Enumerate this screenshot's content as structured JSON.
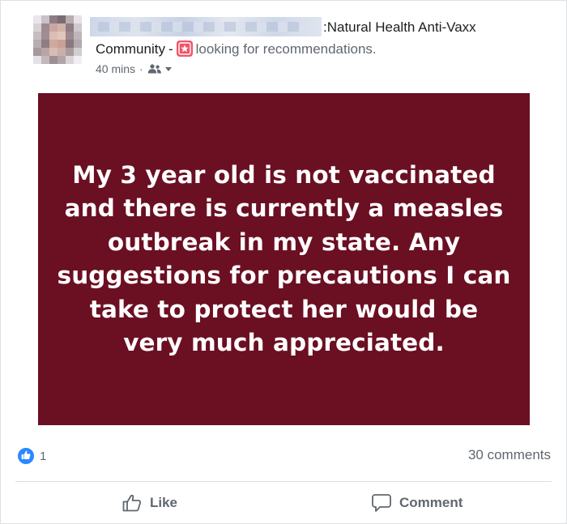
{
  "post": {
    "group_name": ":Natural Health Anti-Vaxx",
    "group_name_cont": "Community",
    "separator": "-",
    "activity": "looking for recommendations.",
    "time": "40 mins",
    "dot": "·",
    "audience_icon": "group-icon",
    "image_text": "My 3 year old is not vaccinated and there is currently a measles outbreak in my state. Any suggestions for precautions I can take to protect her would be very much appreciated.",
    "image_bg_color": "#6b0f22"
  },
  "reactions": {
    "like_count": "1",
    "comments": "30 comments"
  },
  "actions": {
    "like_label": "Like",
    "comment_label": "Comment"
  },
  "colors": {
    "accent_blue": "#2d88ff",
    "badge_pink": "#f25268",
    "secondary_text": "#606770"
  }
}
